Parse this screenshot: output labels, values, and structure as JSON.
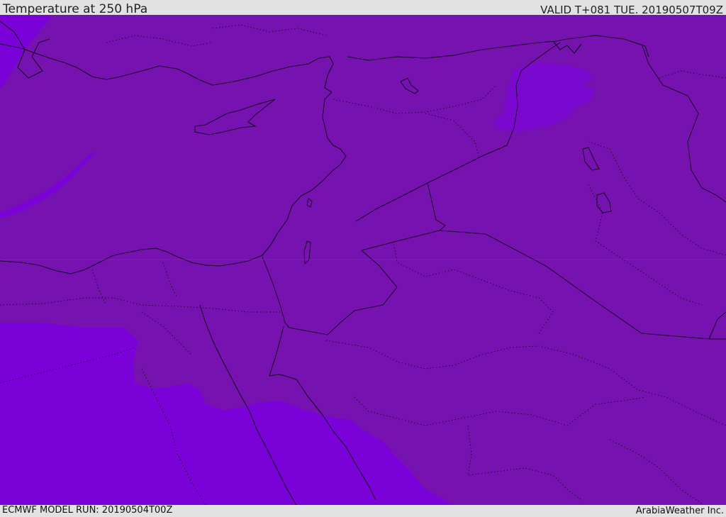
{
  "header": {
    "title": "Temperature at 250 hPa",
    "valid_time": "VALID T+081 TUE. 20190507T09Z"
  },
  "footer": {
    "model_run": "ECMWF MODEL RUN: 20190504T00Z",
    "credit": "ArabiaWeather Inc."
  },
  "colors": {
    "field_dominant": "#7612b0",
    "field_cold": "#7a02d8",
    "field_mid": "#7b08cf",
    "boundary": "#1a0528",
    "bar_background": "#e2e2e2"
  },
  "map": {
    "variable": "temperature",
    "level": "250 hPa",
    "region": "Eastern Mediterranean / Middle East"
  }
}
